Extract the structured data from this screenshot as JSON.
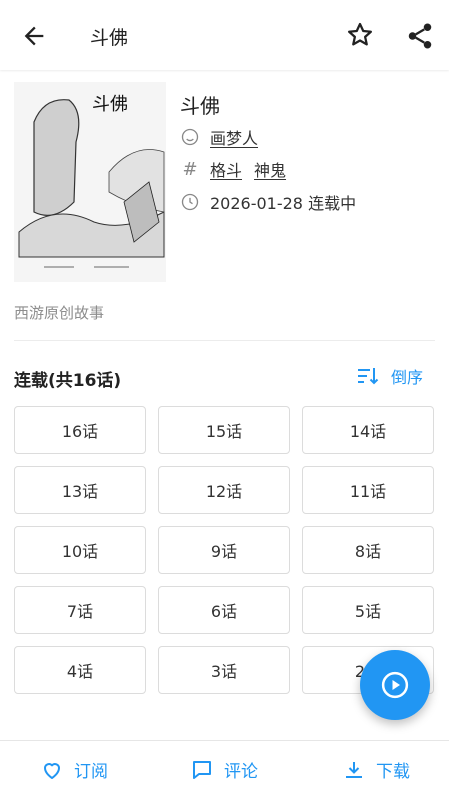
{
  "appbar": {
    "title": "斗佛",
    "back_icon": "arrow-left-icon",
    "star_icon": "star-outline-icon",
    "share_icon": "share-icon"
  },
  "comic": {
    "title": "斗佛",
    "author": "画梦人",
    "tags": [
      "格斗",
      "神鬼"
    ],
    "update": "2026-01-28 连载中",
    "description": "西游原创故事",
    "cover_title": "斗佛"
  },
  "chapters": {
    "title": "连载(共16话)",
    "sort_label": "倒序",
    "items": [
      "16话",
      "15话",
      "14话",
      "13话",
      "12话",
      "11话",
      "10话",
      "9话",
      "8话",
      "7话",
      "6话",
      "5话",
      "4话",
      "3话",
      "2话"
    ]
  },
  "bottom": {
    "subscribe": "订阅",
    "comment": "评论",
    "download": "下载"
  },
  "colors": {
    "accent": "#2196F3"
  }
}
